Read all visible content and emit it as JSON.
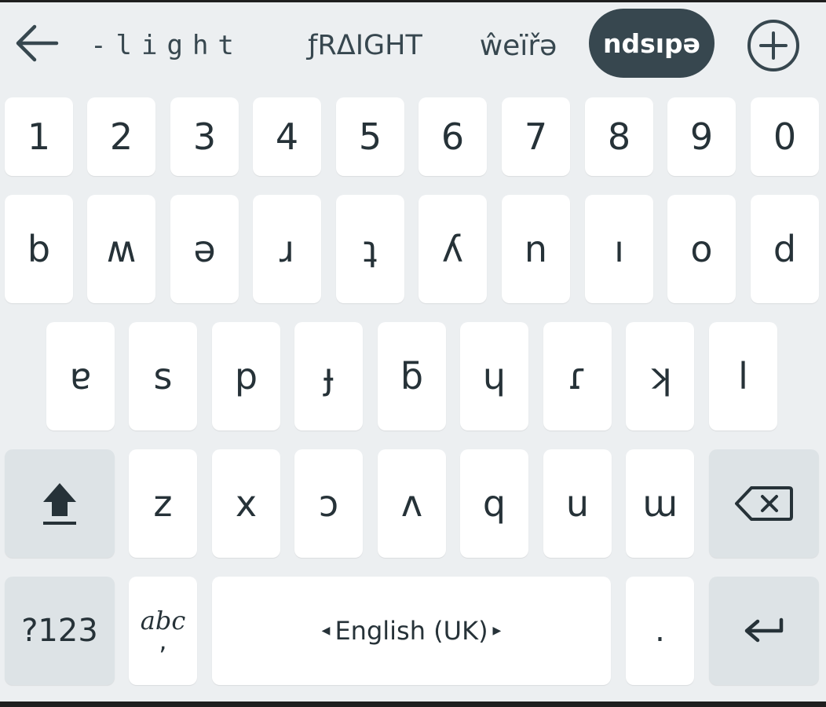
{
  "toolbar": {
    "back_icon": "arrow-left-icon",
    "styles": [
      {
        "label": "-light"
      },
      {
        "label": "ƒRΔIGHT"
      },
      {
        "label": "ŵeïřə"
      },
      {
        "label": "ndsıpə"
      }
    ],
    "add_icon": "plus-circle-icon"
  },
  "rows": {
    "numbers": [
      "1",
      "2",
      "3",
      "4",
      "5",
      "6",
      "7",
      "8",
      "9",
      "0"
    ],
    "row1": [
      "b",
      "ʍ",
      "ǝ",
      "ɹ",
      "ʇ",
      "ʎ",
      "n",
      "ı",
      "o",
      "d"
    ],
    "row2": [
      "ɐ",
      "s",
      "p",
      "ɟ",
      "ƃ",
      "ɥ",
      "ɾ",
      "ʞ",
      "l"
    ],
    "row3": [
      "z",
      "x",
      "ɔ",
      "ʌ",
      "q",
      "u",
      "ɯ"
    ]
  },
  "special": {
    "shift_icon": "shift-up-arrow-icon",
    "backspace_icon": "backspace-icon",
    "symbols_label": "?123",
    "emoji_label_top": "abc",
    "emoji_label_bottom": ",",
    "space_label": "English (UK)",
    "period_label": ".",
    "enter_icon": "enter-arrow-icon"
  },
  "colors": {
    "background": "#eceff1",
    "key": "#ffffff",
    "function_key": "#dde3e6",
    "text": "#263238",
    "selected_chip": "#37474f"
  }
}
